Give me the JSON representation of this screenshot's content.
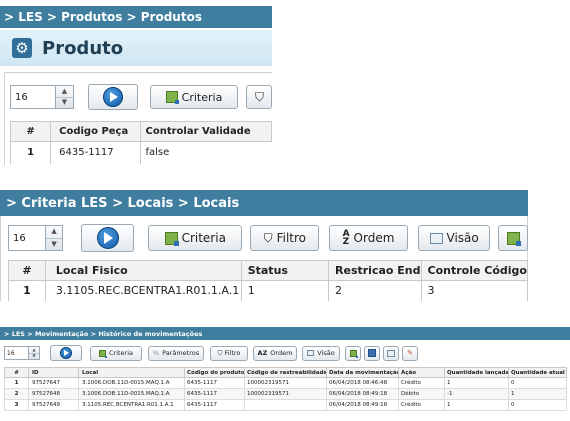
{
  "panel1": {
    "breadcrumb": "> LES > Produtos > Produtos",
    "title": "Produto",
    "spinner_value": "16",
    "criteria_label": "Criteria",
    "columns": [
      "#",
      "Codigo Peça",
      "Controlar Validade"
    ],
    "rows": [
      [
        "1",
        "6435-1117",
        "false"
      ]
    ]
  },
  "panel2": {
    "breadcrumb": "> Criteria LES > Locais > Locais",
    "spinner_value": "16",
    "criteria_label": "Criteria",
    "filtro_label": "Filtro",
    "ordem_label": "Ordem",
    "visao_label": "Visão",
    "columns": [
      "#",
      "Local Fisico",
      "Status",
      "Restricao End",
      "Controle Código"
    ],
    "rows": [
      [
        "1",
        "3.1105.REC.BCENTRA1.R01.1.A.1",
        "1",
        "2",
        "3"
      ]
    ]
  },
  "panel3": {
    "breadcrumb": "> LES > Movimentação > Histórico de movimentações",
    "spinner_value": "16",
    "criteria_label": "Criteria",
    "parametros_label": "Parâmetros",
    "filtro_label": "Filtro",
    "ordem_label": "Ordem",
    "visao_label": "Visão",
    "columns": [
      "#",
      "ID",
      "Local",
      "Código do produto",
      "Código de rastreabilidade",
      "Data da movimentação",
      "Ação",
      "Quantidade lançada",
      "Quantidade atual"
    ],
    "rows": [
      [
        "1",
        "97527647",
        "3.1006.DOB.11D-0015.MAQ.1.A",
        "6435-1117",
        "100002319571",
        "06/04/2018 08:46:48",
        "Crédito",
        "1",
        "0"
      ],
      [
        "2",
        "97527648",
        "3.1006.DOB.11D-0015.MAQ.1.A",
        "6435-1117",
        "100002319571",
        "06/04/2018 08:49:18",
        "Débito",
        "-1",
        "1"
      ],
      [
        "3",
        "97527649",
        "3.1105.REC.BCENTRA1.R01.1.A.1",
        "6435-1117",
        "",
        "06/04/2018 08:49:18",
        "Crédito",
        "1",
        "0"
      ]
    ]
  },
  "colors": {
    "breadcrumb_bg": "#3f7e9e",
    "title_bg": "#d6ecf6",
    "table_header_bg": "#eeeeee"
  }
}
